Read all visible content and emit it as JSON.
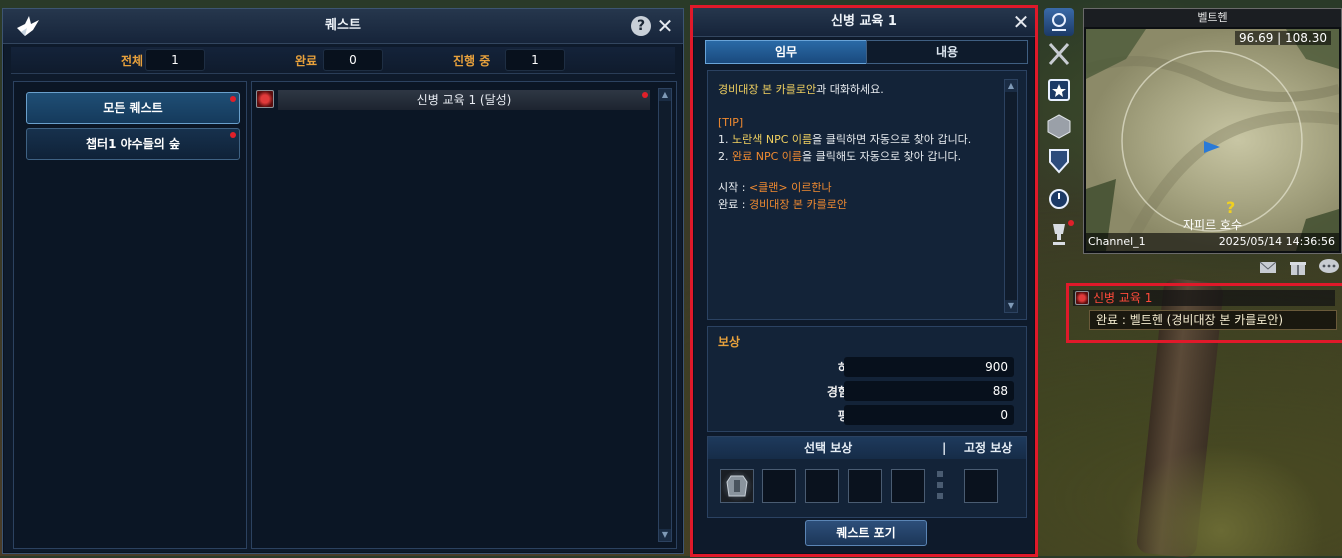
{
  "quest_window": {
    "title": "퀘스트",
    "stats": {
      "total_label": "전체",
      "total_value": "1",
      "done_label": "완료",
      "done_value": "0",
      "progress_label": "진행 중",
      "progress_value": "1"
    },
    "categories": [
      {
        "label": "모든 퀘스트",
        "active": true
      },
      {
        "label": "챕터1 야수들의 숲",
        "active": false
      }
    ],
    "quests": [
      {
        "title": "신병 교육 1 (달성)"
      }
    ]
  },
  "detail_window": {
    "title": "신병 교육 1",
    "tabs": [
      "임무",
      "내용"
    ],
    "content": {
      "line1_npc": "경비대장 본 카를로안",
      "line1_rest": "과 대화하세요.",
      "tip_header": "[TIP]",
      "tip1_prefix": "1. ",
      "tip1_highlight": "노란색 NPC 이름",
      "tip1_rest": "을 클릭하면 자동으로 찾아 갑니다.",
      "tip2_prefix": "2. ",
      "tip2_highlight": "완료 NPC 이름",
      "tip2_rest": "을 클릭해도 자동으로 찾아 갑니다.",
      "start_label": "시작 : ",
      "start_value": "<클랜> 이르한나",
      "end_label": "완료 : ",
      "end_value": "경비대장 본 카를로안"
    },
    "rewards": {
      "title": "보상",
      "items": [
        {
          "label": "하임",
          "value": "900"
        },
        {
          "label": "경험치",
          "value": "88"
        },
        {
          "label": "평판",
          "value": "0"
        }
      ]
    },
    "select_reward_label": "선택 보상",
    "divider": "|",
    "fixed_reward_label": "고정 보상",
    "give_up_label": "퀘스트 포기"
  },
  "minimap": {
    "region": "벨트헨",
    "coords": "96.69 | 108.30",
    "location": "자피르 호수",
    "channel": "Channel_1",
    "datetime": "2025/05/14 14:36:56"
  },
  "tracker": {
    "title": "신병 교육 1",
    "subtitle": "완료 : 벨트헨 (경비대장 본 카를로안)"
  },
  "colors": {
    "accent_orange": "#e8a13c",
    "highlight_red": "#e0192a",
    "npc_yellow": "#f0d060",
    "complete_orange": "#f08a30"
  }
}
